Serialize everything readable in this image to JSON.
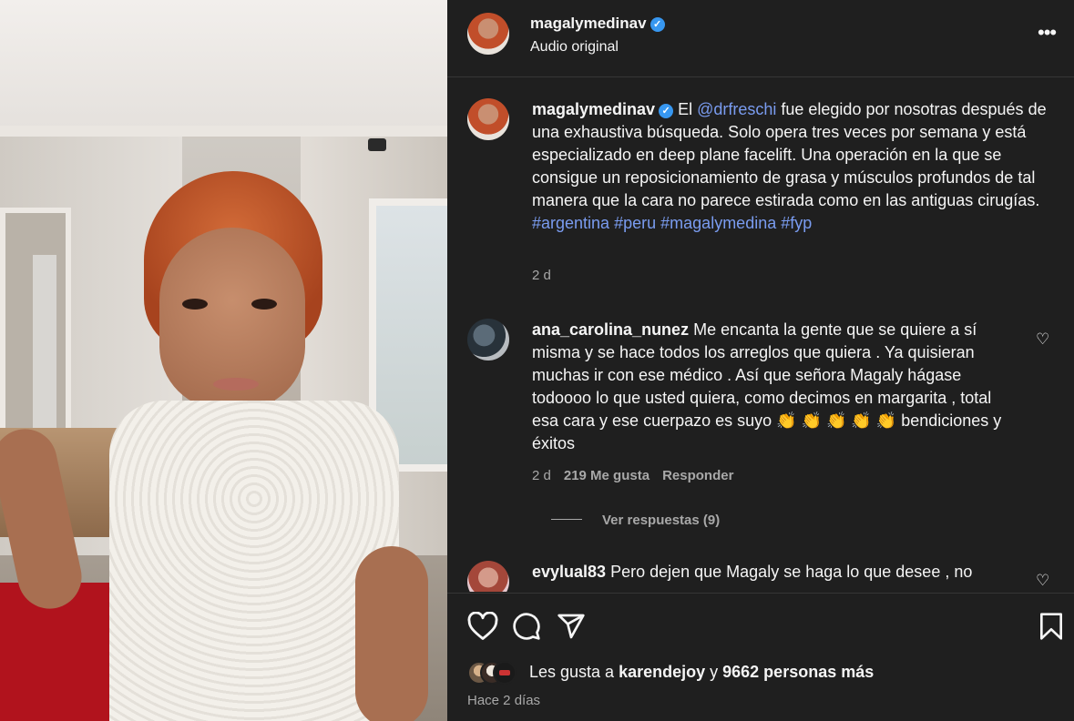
{
  "post": {
    "username": "magalymedinav",
    "verified_mark": "✓",
    "audio": "Audio original",
    "more_icon": "•••"
  },
  "caption": {
    "username": "magalymedinav",
    "before_mention": " El ",
    "mention": "@drfreschi",
    "body": " fue elegido por nosotras después de una exhaustiva búsqueda. Solo opera tres veces por semana y está especializado en deep plane facelift. Una operación en la que se consigue un reposicionamiento de grasa y músculos profundos de tal manera que la cara no parece estirada como en las antiguas cirugías. ",
    "hashtags": [
      "#argentina",
      "#peru",
      "#magalymedina",
      "#fyp"
    ],
    "time": "2 d"
  },
  "comments": [
    {
      "username": "ana_carolina_nunez",
      "text": " Me encanta la gente que se quiere a sí misma y se hace todos los arreglos que quiera . Ya quisieran muchas ir con ese médico . Así que señora Magaly hágase todoooo lo que usted quiera, como decimos en margarita , total esa cara y ese cuerpazo es suyo 👏 👏 👏 👏 👏 bendiciones y éxitos",
      "time": "2 d",
      "likes": "219 Me gusta",
      "reply": "Responder",
      "view_replies": "Ver respuestas (9)"
    },
    {
      "username": "evylual83",
      "text": " Pero dejen que Magaly se haga lo que desee , no"
    }
  ],
  "actions": {
    "likes_prefix": "Les gusta a ",
    "likes_user": "karendejoy",
    "likes_mid": " y ",
    "likes_count": "9662 personas más",
    "time_ago": "Hace 2 días"
  },
  "icons": {
    "like": "heart-icon",
    "comment": "comment-icon",
    "share": "share-icon",
    "save": "bookmark-icon",
    "comment_like": "♡"
  },
  "colors": {
    "background": "#1f1f1f",
    "link": "#7a9cf0",
    "verified": "#3797f0",
    "muted": "#a8a8a8"
  }
}
